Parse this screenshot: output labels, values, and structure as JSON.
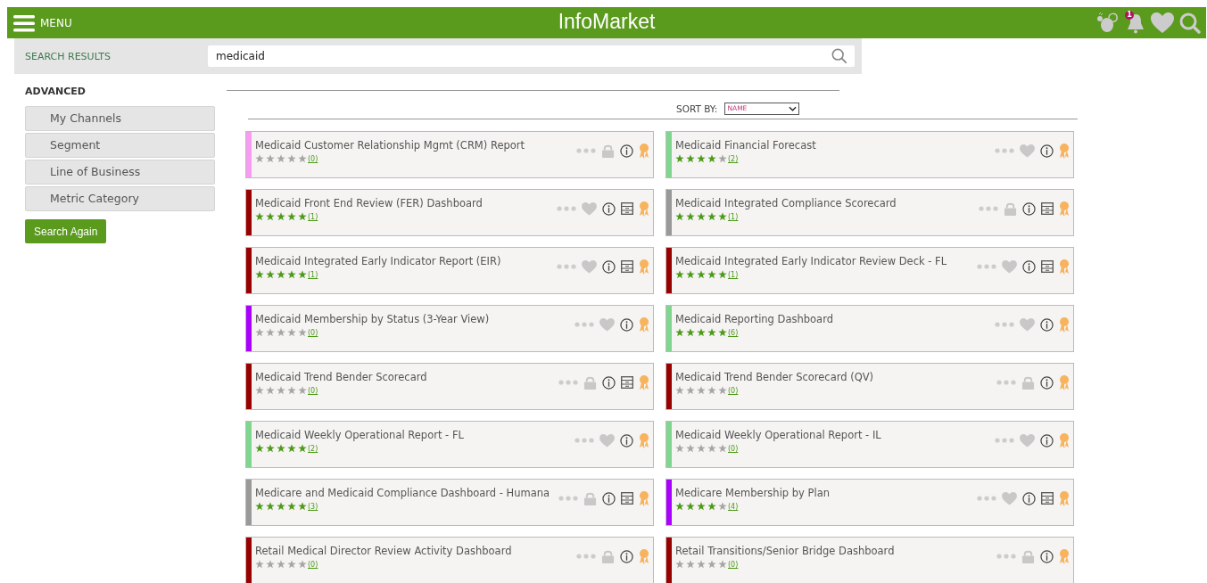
{
  "header": {
    "menu_label": "MENU",
    "title": "InfoMarket",
    "notification_count": "1"
  },
  "search": {
    "section_label": "SEARCH RESULTS",
    "value": "medicaid"
  },
  "sidebar": {
    "heading": "ADVANCED",
    "items": [
      "My Channels",
      "Segment",
      "Line of Business",
      "Metric Category"
    ],
    "button": "Search Again"
  },
  "sort": {
    "label": "SORT BY:",
    "value": "NAME"
  },
  "cards": [
    {
      "title": "Medicaid Customer Relationship Mgmt (CRM) Report",
      "stars": 0,
      "count": "(0)",
      "color": "#f79cf0",
      "locked": true,
      "table": false
    },
    {
      "title": "Medicaid Financial Forecast",
      "stars": 4,
      "count": "(2)",
      "color": "#7fd68f",
      "locked": false,
      "table": false
    },
    {
      "title": "Medicaid Front End Review (FER) Dashboard",
      "stars": 5,
      "count": "(1)",
      "color": "#990000",
      "locked": false,
      "table": true
    },
    {
      "title": "Medicaid Integrated Compliance Scorecard",
      "stars": 5,
      "count": "(1)",
      "color": "#999999",
      "locked": true,
      "table": true
    },
    {
      "title": "Medicaid Integrated Early Indicator Report (EIR)",
      "stars": 5,
      "count": "(1)",
      "color": "#990000",
      "locked": false,
      "table": true
    },
    {
      "title": "Medicaid Integrated Early Indicator Review Deck - FL",
      "stars": 5,
      "count": "(1)",
      "color": "#990000",
      "locked": false,
      "table": true
    },
    {
      "title": "Medicaid Membership by Status (3-Year View)",
      "stars": 0,
      "count": "(0)",
      "color": "#aa00ff",
      "locked": false,
      "table": false
    },
    {
      "title": "Medicaid Reporting Dashboard",
      "stars": 5,
      "count": "(6)",
      "color": "#7fd68f",
      "locked": false,
      "table": false
    },
    {
      "title": "Medicaid Trend Bender Scorecard",
      "stars": 0,
      "count": "(0)",
      "color": "#990000",
      "locked": true,
      "table": true
    },
    {
      "title": "Medicaid Trend Bender Scorecard (QV)",
      "stars": 0,
      "count": "(0)",
      "color": "#990000",
      "locked": true,
      "table": false
    },
    {
      "title": "Medicaid Weekly Operational Report - FL",
      "stars": 5,
      "count": "(2)",
      "color": "#7fd68f",
      "locked": false,
      "table": false
    },
    {
      "title": "Medicaid Weekly Operational Report - IL",
      "stars": 0,
      "count": "(0)",
      "color": "#7fd68f",
      "locked": false,
      "table": false
    },
    {
      "title": "Medicare and Medicaid Compliance Dashboard - Humana",
      "stars": 5,
      "count": "(3)",
      "color": "#999999",
      "locked": true,
      "table": true
    },
    {
      "title": "Medicare Membership by Plan",
      "stars": 4,
      "count": "(4)",
      "color": "#aa00ff",
      "locked": false,
      "table": true
    },
    {
      "title": "Retail Medical Director Review Activity Dashboard",
      "stars": 0,
      "count": "(0)",
      "color": "#990000",
      "locked": true,
      "table": false
    },
    {
      "title": "Retail Transitions/Senior Bridge Dashboard",
      "stars": 0,
      "count": "(0)",
      "color": "#990000",
      "locked": true,
      "table": false
    }
  ]
}
